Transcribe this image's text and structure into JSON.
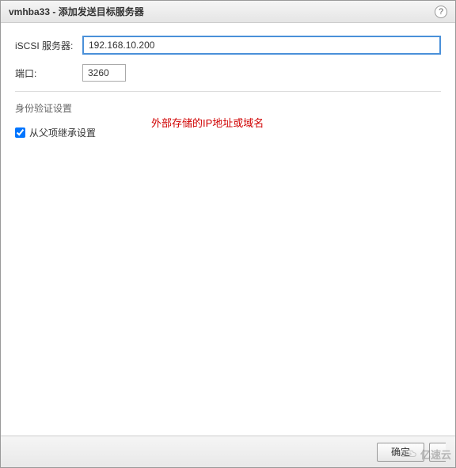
{
  "titlebar": {
    "title": "vmhba33 - 添加发送目标服务器"
  },
  "form": {
    "server_label": "iSCSI 服务器:",
    "server_value": "192.168.10.200",
    "port_label": "端口:",
    "port_value": "3260"
  },
  "auth": {
    "section_title": "身份验证设置",
    "inherit_label": "从父项继承设置",
    "inherit_checked": true
  },
  "annotation": {
    "text": "外部存储的IP地址或域名"
  },
  "footer": {
    "ok_label": "确定"
  },
  "watermark": {
    "text": "亿速云"
  }
}
